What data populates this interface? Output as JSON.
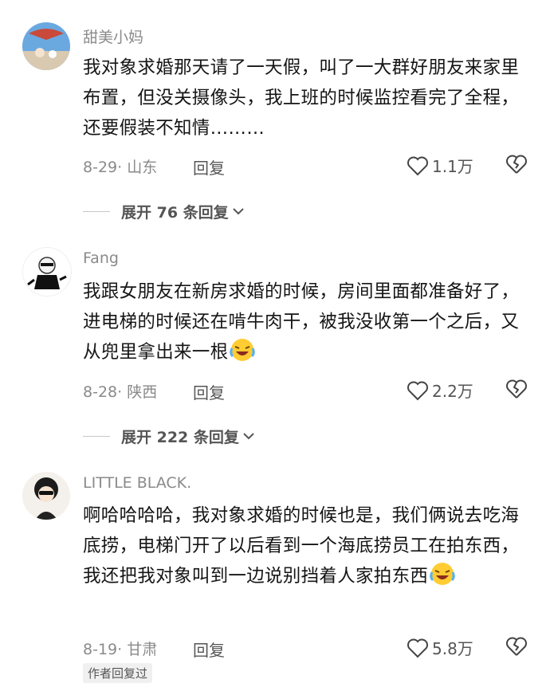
{
  "comments": [
    {
      "username": "甜美小妈",
      "text": "我对象求婚那天请了一天假，叫了一大群好朋友来家里布置，但没关摄像头，我上班的时候监控看完了全程，还要假装不知情………",
      "date": "8-29",
      "location": "山东",
      "reply_label": "回复",
      "likes": "1.1万",
      "expand_label": "展开 76 条回复"
    },
    {
      "username": "Fang",
      "text": "我跟女朋友在新房求婚的时候，房间里面都准备好了，进电梯的时候还在啃牛肉干，被我没收第一个之后，又从兜里拿出来一根",
      "date": "8-28",
      "location": "陕西",
      "reply_label": "回复",
      "likes": "2.2万",
      "expand_label": "展开 222 条回复"
    },
    {
      "username": "LITTLE BLACK.",
      "text": "啊哈哈哈哈，我对象求婚的时候也是，我们俩说去吃海底捞，电梯门开了以后看到一个海底捞员工在拍东西，我还把我对象叫到一边说别挡着人家拍东西",
      "date": "8-19",
      "location": "甘肃",
      "reply_label": "回复",
      "likes": "5.8万",
      "badge": "作者回复过"
    }
  ],
  "icons": {
    "like": "heart-outline-icon",
    "dislike": "broken-heart-icon",
    "expand": "chevron-down-icon",
    "emoji": "laughing-crying-emoji-icon"
  }
}
